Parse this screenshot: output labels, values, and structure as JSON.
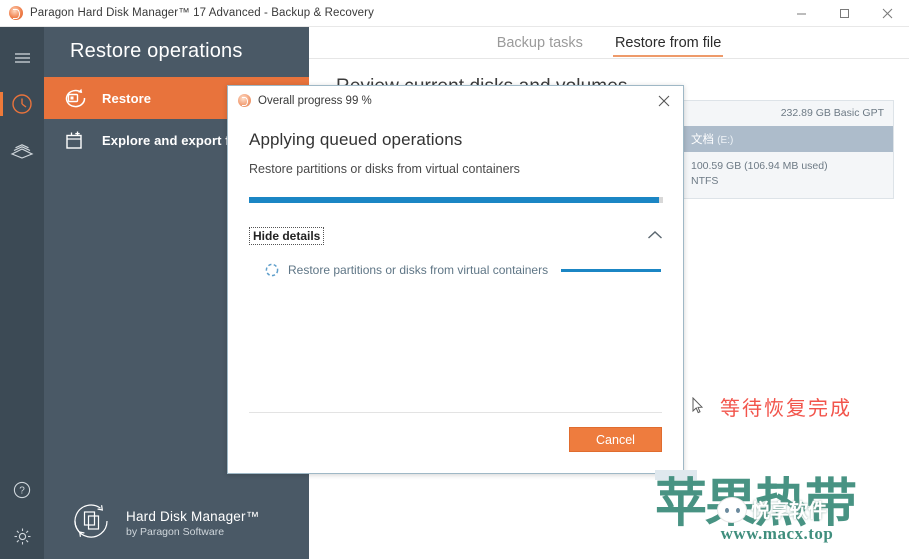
{
  "window": {
    "title": "Paragon Hard Disk Manager™ 17 Advanced - Backup & Recovery",
    "app_icon": "paragon-icon",
    "controls": {
      "minimize": "minimize-icon",
      "maximize": "maximize-icon",
      "close": "close-icon"
    }
  },
  "rail": {
    "menu_icon": "hamburger-icon",
    "items": [
      {
        "icon": "clock-history-icon",
        "active": true
      },
      {
        "icon": "disk-stack-icon",
        "active": false
      }
    ],
    "bottom": [
      {
        "icon": "help-icon"
      },
      {
        "icon": "gear-icon"
      }
    ]
  },
  "sidebar": {
    "heading": "Restore operations",
    "items": [
      {
        "label": "Restore",
        "icon": "restore-icon",
        "active": true
      },
      {
        "label": "Explore and export files",
        "icon": "export-files-icon",
        "active": false
      }
    ]
  },
  "brand": {
    "icon": "hard-disk-manager-logo",
    "name": "Hard Disk Manager™",
    "vendor": "by Paragon Software"
  },
  "main": {
    "tabs": [
      {
        "label": "Backup tasks",
        "active": false
      },
      {
        "label": "Restore from file",
        "active": true
      }
    ],
    "page_title": "Review current disks and volumes",
    "disk": {
      "capacity": "232.89 GB Basic GPT",
      "volume_name": "文档",
      "volume_letter": "(E:)",
      "volume_size": "100.59 GB (106.94 MB used)",
      "filesystem": "NTFS"
    }
  },
  "dialog": {
    "title": "Overall progress 99 %",
    "icon": "paragon-icon",
    "close_icon": "close-icon",
    "heading": "Applying queued operations",
    "subtitle": "Restore partitions or disks from virtual containers",
    "progress_percent": 99,
    "details_toggle": "Hide details",
    "chevron_icon": "chevron-up-icon",
    "task": {
      "spinner_icon": "spinner-icon",
      "label": "Restore partitions or disks from virtual containers",
      "progress_percent": 100
    },
    "overlay_note": "等待恢复完成",
    "cursor_icon": "mouse-pointer-icon",
    "cancel_label": "Cancel"
  },
  "watermark": {
    "main_text": "苹果热带",
    "badge_text": "悦享软件",
    "url": "www.macx.top",
    "color": "#3f8e7d"
  },
  "colors": {
    "accent_orange": "#ee7a3a",
    "sidebar": "#4a5966",
    "rail": "#3c4a55",
    "progress_blue": "#1b86c4",
    "note_red": "#f2544b"
  }
}
